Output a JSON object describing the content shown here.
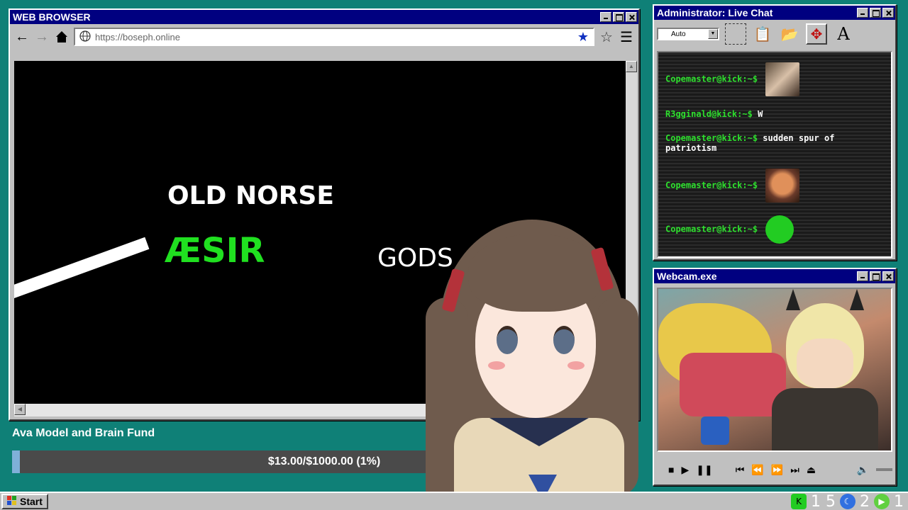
{
  "browser": {
    "title": "WEB BROWSER",
    "url": "https://boseph.online",
    "icons": [
      "back-arrow-icon",
      "forward-arrow-icon",
      "home-icon",
      "globe-icon",
      "bookmark-star-icon",
      "star-outline-icon",
      "hamburger-menu-icon"
    ],
    "video": {
      "line1": "OLD NORSE",
      "line2": "ÆSIR",
      "line3": "GODS"
    }
  },
  "fund": {
    "title": "Ava Model and Brain Fund",
    "progress_text": "$13.00/$1000.00 (1%)",
    "progress_fraction": 0.013
  },
  "chat": {
    "title": "Administrator: Live Chat",
    "select_value": "Auto",
    "messages": [
      {
        "user": "Copemaster@kick:~$",
        "text": "",
        "emote": "photo-emote"
      },
      {
        "user": "R3gginald@kick:~$",
        "text": "W",
        "emote": ""
      },
      {
        "user": "Copemaster@kick:~$",
        "text": "sudden spur of",
        "text2": "patriotism",
        "emote": ""
      },
      {
        "user": "Copemaster@kick:~$",
        "text": "",
        "emote": "shouting-face-emote"
      },
      {
        "user": "Copemaster@kick:~$",
        "text": "",
        "emote": "green-blob-emote"
      }
    ]
  },
  "webcam": {
    "title": "Webcam.exe"
  },
  "taskbar": {
    "start_label": "Start",
    "tray": {
      "count1": "1 5",
      "count2": "2",
      "count3": "1"
    }
  },
  "colors": {
    "desktop": "#0f8077",
    "titlebar": "#000080",
    "chat_user": "#2ee02e",
    "aesir": "#20e020"
  }
}
